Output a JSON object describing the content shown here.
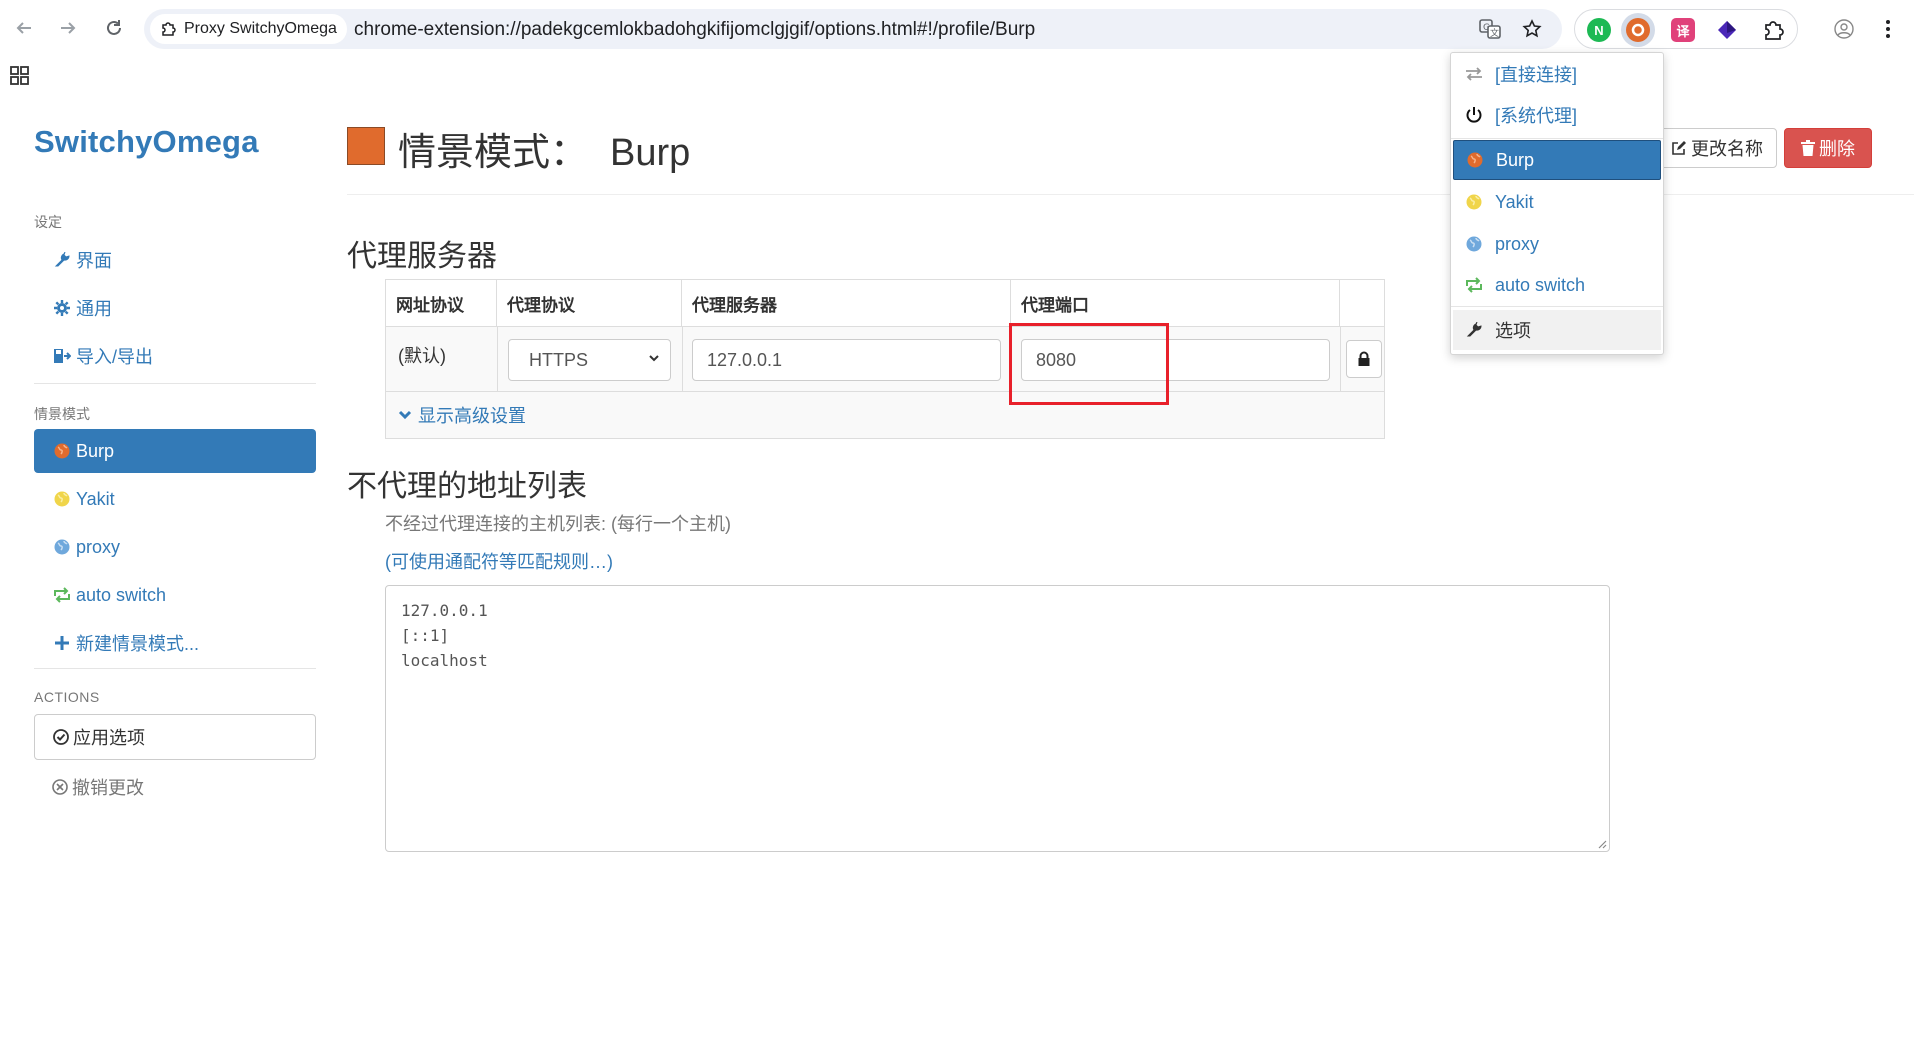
{
  "browser": {
    "tab_title": "Proxy SwitchyOmega",
    "url": "chrome-extension://padekgcemlokbadohgkifijomclgjgif/options.html#!/profile/Burp",
    "extensions": [
      {
        "name": "n-extension-icon",
        "label": "N",
        "color": "#1db954"
      },
      {
        "name": "switchyomega-icon",
        "label": "",
        "color": "#e06b2d"
      },
      {
        "name": "translate-extension-icon",
        "label": "译",
        "color": "#e0417a"
      },
      {
        "name": "purple-cube-extension-icon",
        "label": "",
        "color": "#4b28b8"
      }
    ]
  },
  "sidebar": {
    "brand": "SwitchyOmega",
    "settings_header": "设定",
    "settings_items": [
      {
        "label": "界面",
        "icon": "wrench-icon"
      },
      {
        "label": "通用",
        "icon": "gear-icon"
      },
      {
        "label": "导入/导出",
        "icon": "import-export-icon"
      }
    ],
    "profiles_header": "情景模式",
    "profiles": [
      {
        "label": "Burp",
        "icon": "globe-icon",
        "color": "#e06b2d",
        "active": true
      },
      {
        "label": "Yakit",
        "icon": "globe-icon",
        "color": "#f0d54a"
      },
      {
        "label": "proxy",
        "icon": "globe-icon",
        "color": "#5b9bd5"
      },
      {
        "label": "auto switch",
        "icon": "auto-switch-icon",
        "color": "#5cb85c"
      },
      {
        "label": "新建情景模式...",
        "icon": "plus-icon"
      }
    ],
    "actions_header": "ACTIONS",
    "apply_label": "应用选项",
    "discard_label": "撤销更改"
  },
  "main": {
    "title_prefix": "情景模式：",
    "profile_name": "Burp",
    "profile_color": "#e06b2d",
    "rename_label": "更改名称",
    "delete_label": "删除",
    "proxy_section": "代理服务器",
    "table_headers": [
      "网址协议",
      "代理协议",
      "代理服务器",
      "代理端口"
    ],
    "row": {
      "scheme": "(默认)",
      "protocol": "HTTPS",
      "server": "127.0.0.1",
      "port": "8080"
    },
    "advanced_label": "显示高级设置",
    "bypass_section": "不代理的地址列表",
    "bypass_help": "不经过代理连接的主机列表: (每行一个主机)",
    "bypass_link": "(可使用通配符等匹配规则…)",
    "bypass_list": "127.0.0.1\n[::1]\nlocalhost"
  },
  "popup": {
    "items": [
      {
        "label": "[直接连接]",
        "icon": "direct-arrows-icon"
      },
      {
        "label": "[系统代理]",
        "icon": "power-icon"
      },
      {
        "label": "Burp",
        "icon": "globe-icon",
        "active": true
      },
      {
        "label": "Yakit",
        "icon": "globe-icon"
      },
      {
        "label": "proxy",
        "icon": "globe-icon"
      },
      {
        "label": "auto switch",
        "icon": "auto-switch-icon"
      },
      {
        "label": "选项",
        "icon": "wrench-icon"
      }
    ]
  },
  "colors": {
    "accent": "#337ab7",
    "danger": "#d9534f",
    "highlight": "#e8202a"
  }
}
